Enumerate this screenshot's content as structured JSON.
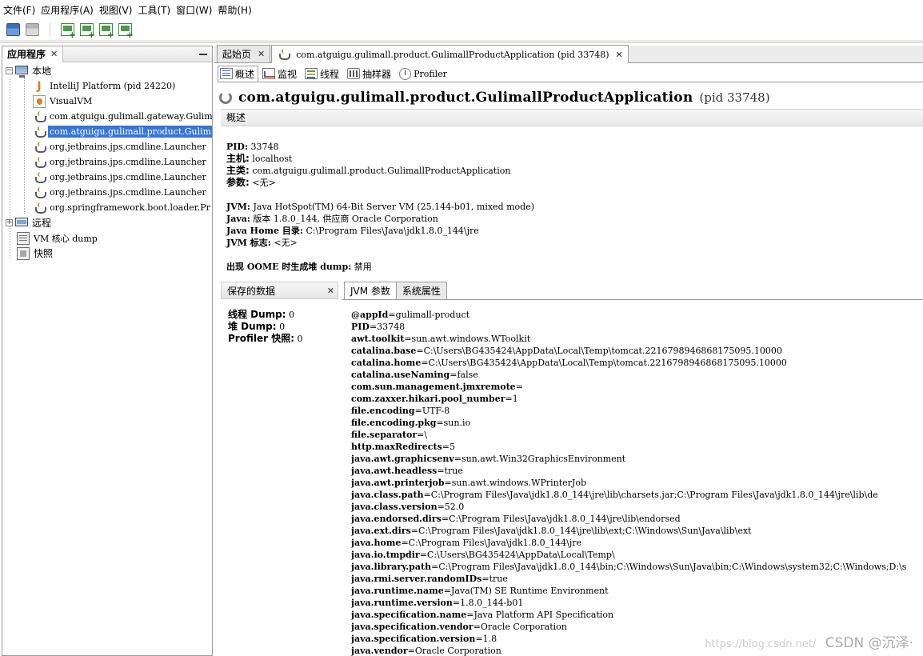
{
  "menu": [
    "文件(F)",
    "应用程序(A)",
    "视图(V)",
    "工具(T)",
    "窗口(W)",
    "帮助(H)"
  ],
  "toolbar_icons": [
    "open-icon",
    "save-icon",
    "add-host-icon",
    "add-jmx-icon",
    "add-dump-icon",
    "add-snapshot-icon"
  ],
  "left": {
    "tab_label": "应用程序",
    "close": "✕",
    "local_label": "本地",
    "apps": [
      "IntelliJ Platform (pid 24220)",
      "VisualVM",
      "com.atguigu.gulimall.gateway.Gulim",
      "com.atguigu.gulimall.product.Gulim",
      "org.jetbrains.jps.cmdline.Launcher",
      "org.jetbrains.jps.cmdline.Launcher",
      "org.jetbrains.jps.cmdline.Launcher",
      "org.jetbrains.jps.cmdline.Launcher",
      "org.springframework.boot.loader.Pr"
    ],
    "remote_label": "远程",
    "core_dump_label": "VM 核心 dump",
    "snapshot_label": "快照"
  },
  "tabs": {
    "start_label": "起始页",
    "app_label": "com.atguigu.gulimall.product.GulimallProductApplication (pid 33748)",
    "close": "✕"
  },
  "subtabs": {
    "overview": "概述",
    "monitor": "监视",
    "threads": "线程",
    "sampler": "抽样器",
    "profiler": "Profiler"
  },
  "title": {
    "name": "com.atguigu.gulimall.product.GulimallProductApplication",
    "pid": "(pid 33748)"
  },
  "overview_section_label": "概述",
  "info": {
    "pid_label": "PID:",
    "pid_value": "33748",
    "host_label": "主机:",
    "host_value": "localhost",
    "mainclass_label": "主类:",
    "mainclass_value": "com.atguigu.gulimall.product.GulimallProductApplication",
    "args_label": "参数:",
    "args_value": "<无>",
    "jvm_label": "JVM:",
    "jvm_value": "Java HotSpot(TM) 64-Bit Server VM (25.144-b01, mixed mode)",
    "java_label": "Java:",
    "java_value": "版本 1.8.0_144, 供应商 Oracle Corporation",
    "javahome_label": "Java Home 目录:",
    "javahome_value": "C:\\Program Files\\Java\\jdk1.8.0_144\\jre",
    "jvmflags_label": "JVM 标志:",
    "jvmflags_value": "<无>",
    "oome_label": "出现 OOME 时生成堆 dump:",
    "oome_value": "禁用"
  },
  "saved": {
    "header": "保存的数据",
    "close": "✕",
    "thread_dump_label": "线程 Dump:",
    "thread_dump_value": "0",
    "heap_dump_label": "堆 Dump:",
    "heap_dump_value": "0",
    "profiler_snap_label": "Profiler 快照:",
    "profiler_snap_value": "0"
  },
  "prop_tabs": {
    "jvm_args": "JVM 参数",
    "sys_props": "系统属性"
  },
  "props": [
    {
      "k": "@appId",
      "v": "=gulimall-product"
    },
    {
      "k": "PID",
      "v": "=33748"
    },
    {
      "k": "awt.toolkit",
      "v": "=sun.awt.windows.WToolkit"
    },
    {
      "k": "catalina.base",
      "v": "=C:\\Users\\BG435424\\AppData\\Local\\Temp\\tomcat.2216798946868175095.10000"
    },
    {
      "k": "catalina.home",
      "v": "=C:\\Users\\BG435424\\AppData\\Local\\Temp\\tomcat.2216798946868175095.10000"
    },
    {
      "k": "catalina.useNaming",
      "v": "=false"
    },
    {
      "k": "com.sun.management.jmxremote",
      "v": "="
    },
    {
      "k": "com.zaxxer.hikari.pool_number",
      "v": "=1"
    },
    {
      "k": "file.encoding",
      "v": "=UTF-8"
    },
    {
      "k": "file.encoding.pkg",
      "v": "=sun.io"
    },
    {
      "k": "file.separator",
      "v": "=\\"
    },
    {
      "k": "http.maxRedirects",
      "v": "=5"
    },
    {
      "k": "java.awt.graphicsenv",
      "v": "=sun.awt.Win32GraphicsEnvironment"
    },
    {
      "k": "java.awt.headless",
      "v": "=true"
    },
    {
      "k": "java.awt.printerjob",
      "v": "=sun.awt.windows.WPrinterJob"
    },
    {
      "k": "java.class.path",
      "v": "=C:\\Program Files\\Java\\jdk1.8.0_144\\jre\\lib\\charsets.jar;C:\\Program Files\\Java\\jdk1.8.0_144\\jre\\lib\\de"
    },
    {
      "k": "java.class.version",
      "v": "=52.0"
    },
    {
      "k": "java.endorsed.dirs",
      "v": "=C:\\Program Files\\Java\\jdk1.8.0_144\\jre\\lib\\endorsed"
    },
    {
      "k": "java.ext.dirs",
      "v": "=C:\\Program Files\\Java\\jdk1.8.0_144\\jre\\lib\\ext;C:\\Windows\\Sun\\Java\\lib\\ext"
    },
    {
      "k": "java.home",
      "v": "=C:\\Program Files\\Java\\jdk1.8.0_144\\jre"
    },
    {
      "k": "java.io.tmpdir",
      "v": "=C:\\Users\\BG435424\\AppData\\Local\\Temp\\"
    },
    {
      "k": "java.library.path",
      "v": "=C:\\Program Files\\Java\\jdk1.8.0_144\\bin;C:\\Windows\\Sun\\Java\\bin;C:\\Windows\\system32;C:\\Windows;D:\\s"
    },
    {
      "k": "java.rmi.server.randomIDs",
      "v": "=true"
    },
    {
      "k": "java.runtime.name",
      "v": "=Java(TM) SE Runtime Environment"
    },
    {
      "k": "java.runtime.version",
      "v": "=1.8.0_144-b01"
    },
    {
      "k": "java.specification.name",
      "v": "=Java Platform API Specification"
    },
    {
      "k": "java.specification.vendor",
      "v": "=Oracle Corporation"
    },
    {
      "k": "java.specification.version",
      "v": "=1.8"
    },
    {
      "k": "java.vendor",
      "v": "=Oracle Corporation"
    }
  ],
  "watermark": {
    "url": "https://blog.csdn.net/",
    "brand": "CSDN @沉泽·"
  },
  "colors": {
    "selection": "#3875d7",
    "border": "#9c9c9c"
  }
}
